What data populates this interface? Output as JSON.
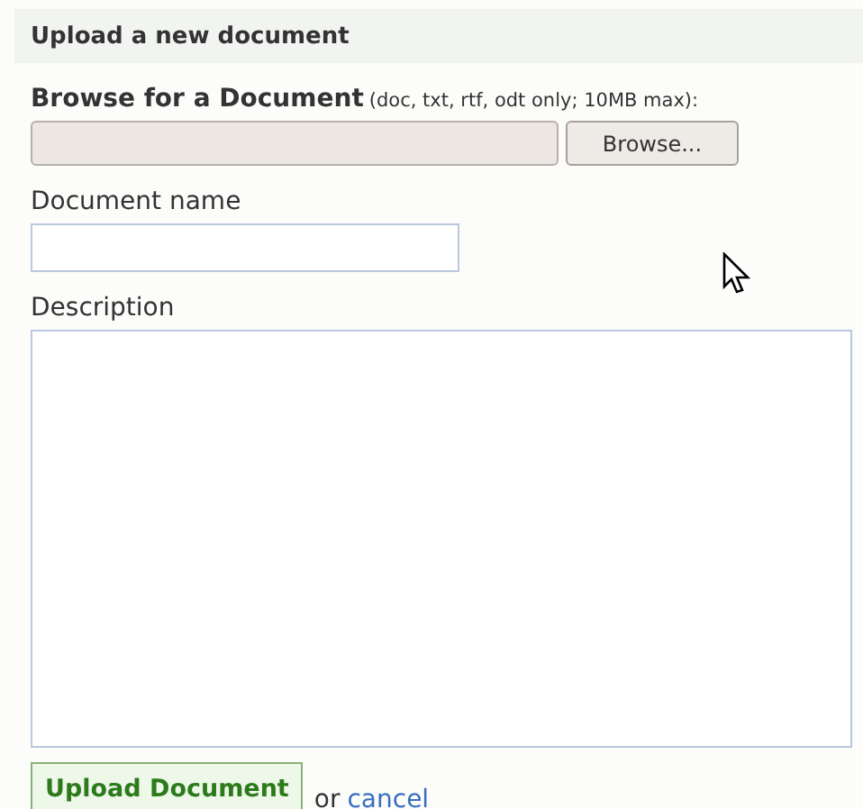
{
  "header": {
    "title": "Upload a new document"
  },
  "file_field": {
    "label": "Browse for a Document",
    "hint": "(doc, txt, rtf, odt only; 10MB max):",
    "button": "Browse..."
  },
  "name_field": {
    "label": "Document name"
  },
  "description_field": {
    "label": "Description"
  },
  "actions": {
    "submit": "Upload Document",
    "separator": "or",
    "cancel": "cancel"
  }
}
